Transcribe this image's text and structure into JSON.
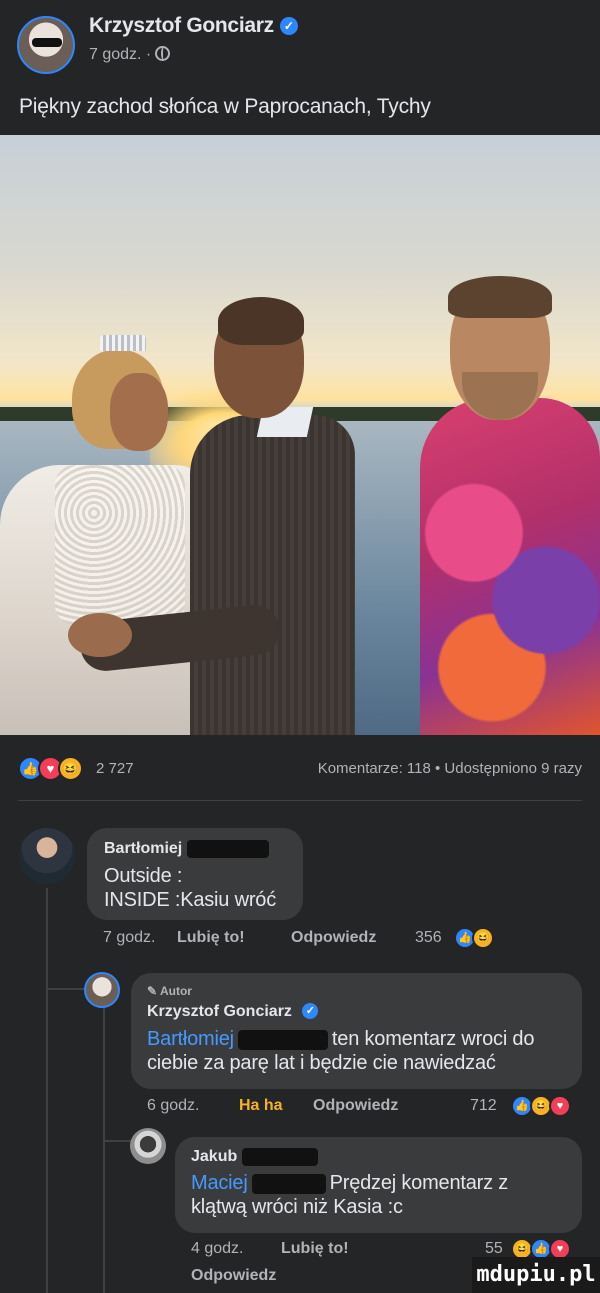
{
  "post": {
    "author": "Krzysztof Gonciarz",
    "time": "7 godz. ·",
    "caption": "Piękny zachod słońca w Paprocanach, Tychy"
  },
  "stats": {
    "reaction_count": "2 727",
    "comments_shares": "Komentarze: 118 • Udostępniono 9 razy"
  },
  "comments": [
    {
      "author": "Bartłomiej",
      "text_line1": "Outside :",
      "text_line2": "INSIDE :Kasiu wróć",
      "time": "7 godz.",
      "like": "Lubię to!",
      "reply": "Odpowiedz",
      "count": "356"
    },
    {
      "badge": "Autor",
      "author": "Krzysztof Gonciarz",
      "mention": "Bartłomiej",
      "text_after_mention": "ten komentarz wroci do",
      "text_line2": "ciebie za parę lat i będzie cie nawiedzać",
      "time": "6 godz.",
      "like": "Ha ha",
      "reply": "Odpowiedz",
      "count": "712"
    },
    {
      "author": "Jakub",
      "mention": "Maciej",
      "text_after_mention": "Prędzej komentarz z",
      "text_line2": "klątwą wróci niż Kasia :c",
      "time": "4 godz.",
      "like": "Lubię to!",
      "reply": "Odpowiedz",
      "count": "55"
    }
  ],
  "icons": {
    "like": "thumbs-up-icon",
    "love": "heart-icon",
    "haha": "laughing-face-icon",
    "globe": "globe-icon",
    "verified": "verified-badge-icon"
  },
  "colors": {
    "background": "#242526",
    "bubble": "#3a3b3c",
    "like_blue": "#2d88ff",
    "love_red": "#f33e58",
    "haha_yellow": "#f7b125",
    "ha_ha_active": "#f7b125",
    "mention_blue": "#4599ff"
  },
  "watermark": "mdupiu.pl"
}
